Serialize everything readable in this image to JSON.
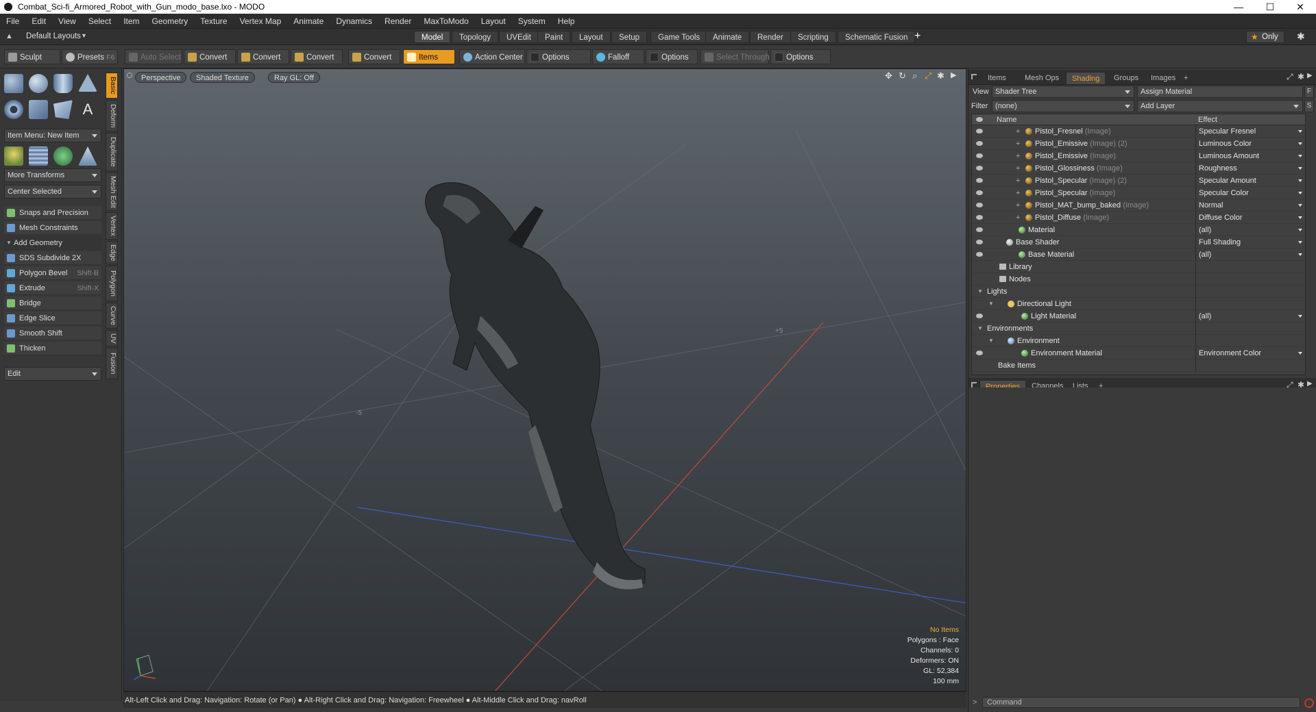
{
  "window": {
    "title": "Combat_Sci-fi_Armored_Robot_with_Gun_modo_base.lxo - MODO",
    "controls": [
      "—",
      "☐",
      "✕"
    ]
  },
  "menubar": [
    "File",
    "Edit",
    "View",
    "Select",
    "Item",
    "Geometry",
    "Texture",
    "Vertex Map",
    "Animate",
    "Dynamics",
    "Render",
    "MaxToModo",
    "Layout",
    "System",
    "Help"
  ],
  "layoutbar": {
    "layouts_label": "Default Layouts",
    "tabs": [
      "Model",
      "Topology",
      "UVEdit",
      "Paint",
      "Layout",
      "Setup",
      "Game Tools",
      "Animate",
      "Render",
      "Scripting",
      "Schematic Fusion"
    ],
    "active_tab": "Model",
    "add": "+",
    "only_label": "Only"
  },
  "toolbar": {
    "sculpt": "Sculpt",
    "presets": "Presets",
    "presets_key": "F6",
    "auto_select": "Auto Select",
    "convert1": "Convert",
    "convert2": "Convert",
    "convert3": "Convert",
    "convert4": "Convert",
    "items": "Items",
    "action_center": "Action Center",
    "options1": "Options",
    "falloff": "Falloff",
    "options2": "Options",
    "select_through": "Select Through",
    "options3": "Options"
  },
  "leftpanel": {
    "item_menu": "Item Menu: New Item",
    "more_transforms": "More Transforms",
    "center_selected": "Center Selected",
    "snaps": "Snaps and Precision",
    "mesh_constraints": "Mesh Constraints",
    "add_geometry": "Add Geometry",
    "tools": [
      {
        "label": "SDS Subdivide 2X",
        "shortcut": ""
      },
      {
        "label": "Polygon Bevel",
        "shortcut": "Shift-B"
      },
      {
        "label": "Extrude",
        "shortcut": "Shift-X"
      },
      {
        "label": "Bridge",
        "shortcut": ""
      },
      {
        "label": "Edge Slice",
        "shortcut": ""
      },
      {
        "label": "Smooth Shift",
        "shortcut": ""
      },
      {
        "label": "Thicken",
        "shortcut": ""
      }
    ],
    "edit": "Edit",
    "vtabs": [
      "Basic",
      "Deform",
      "Duplicate",
      "Mesh Edit",
      "Vertex",
      "Edge",
      "Polygon",
      "Curve",
      "UV",
      "Fusion"
    ]
  },
  "viewport": {
    "perspective": "Perspective",
    "shading": "Shaded Texture",
    "raygl": "Ray GL: Off",
    "info": {
      "items": "No Items",
      "polygons": "Polygons : Face",
      "channels": "Channels: 0",
      "deformers": "Deformers: ON",
      "gl": "GL: 52,384",
      "scale": "100 mm"
    }
  },
  "statusbar": "Alt-Left Click and Drag: Navigation: Rotate (or Pan) ● Alt-Right Click and Drag: Navigation: Freewheel ● Alt-Middle Click and Drag: navRoll",
  "rightpanel": {
    "tabs": [
      "Items",
      "Mesh Ops",
      "Shading",
      "Groups",
      "Images",
      "+"
    ],
    "active_tab": "Shading",
    "view_label": "View",
    "view_value": "Shader Tree",
    "assign_material": "Assign Material",
    "filter_label": "Filter",
    "filter_value": "(none)",
    "add_layer": "Add Layer",
    "f_btn": "F",
    "s_btn": "S",
    "col_name": "Name",
    "col_effect": "Effect",
    "rows": [
      {
        "name": "Pistol_Fresnel",
        "sub": "(Image)",
        "effect": "Specular Fresnel",
        "kind": "img"
      },
      {
        "name": "Pistol_Emissive",
        "sub": "(Image) (2)",
        "effect": "Luminous Color",
        "kind": "img"
      },
      {
        "name": "Pistol_Emissive",
        "sub": "(Image)",
        "effect": "Luminous Amount",
        "kind": "img"
      },
      {
        "name": "Pistol_Glossiness",
        "sub": "(Image)",
        "effect": "Roughness",
        "kind": "img"
      },
      {
        "name": "Pistol_Specular",
        "sub": "(Image) (2)",
        "effect": "Specular Amount",
        "kind": "img"
      },
      {
        "name": "Pistol_Specular",
        "sub": "(Image)",
        "effect": "Specular Color",
        "kind": "img"
      },
      {
        "name": "Pistol_MAT_bump_baked",
        "sub": "(Image)",
        "effect": "Normal",
        "kind": "img"
      },
      {
        "name": "Pistol_Diffuse",
        "sub": "(Image)",
        "effect": "Diffuse Color",
        "kind": "img"
      },
      {
        "name": "Material",
        "sub": "",
        "effect": "(all)",
        "kind": "mat"
      },
      {
        "name": "Base Shader",
        "sub": "",
        "effect": "Full Shading",
        "kind": "shader"
      },
      {
        "name": "Base Material",
        "sub": "",
        "effect": "(all)",
        "kind": "mat"
      },
      {
        "name": "Library",
        "sub": "",
        "effect": "",
        "kind": "folder"
      },
      {
        "name": "Nodes",
        "sub": "",
        "effect": "",
        "kind": "folder"
      },
      {
        "name": "Lights",
        "sub": "",
        "effect": "",
        "kind": "group"
      },
      {
        "name": "Directional Light",
        "sub": "",
        "effect": "",
        "kind": "light"
      },
      {
        "name": "Light Material",
        "sub": "",
        "effect": "(all)",
        "kind": "mat"
      },
      {
        "name": "Environments",
        "sub": "",
        "effect": "",
        "kind": "group"
      },
      {
        "name": "Environment",
        "sub": "",
        "effect": "",
        "kind": "env"
      },
      {
        "name": "Environment Material",
        "sub": "",
        "effect": "Environment Color",
        "kind": "mat"
      },
      {
        "name": "Bake Items",
        "sub": "",
        "effect": "",
        "kind": "plain"
      }
    ],
    "props_tabs": [
      "Properties",
      "Channels",
      "Lists",
      "+"
    ],
    "command_placeholder": "Command"
  }
}
